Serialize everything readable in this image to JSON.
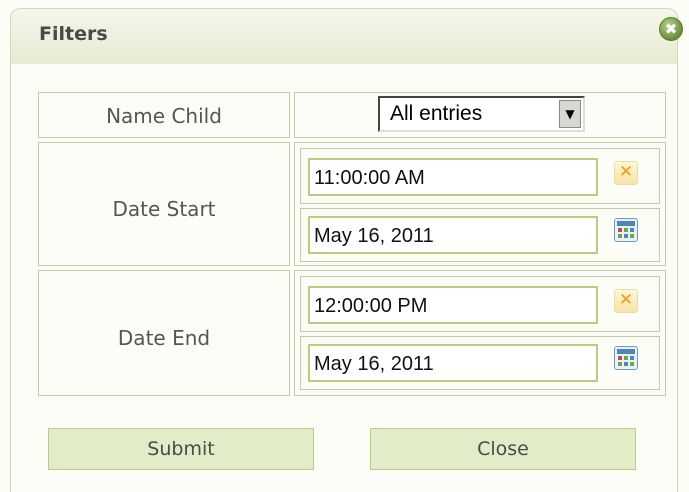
{
  "dialog": {
    "title": "Filters",
    "close_glyph": "✖",
    "accent_color": "#b5cf7d"
  },
  "rows": {
    "name_child": {
      "label": "Name Child",
      "select_value": "All entries",
      "select_arrow": "▼"
    },
    "date_start": {
      "label": "Date Start",
      "time_value": "11:00:00 AM",
      "date_value": "May 16, 2011",
      "clear_icon": "clear-icon",
      "calendar_icon": "calendar-icon"
    },
    "date_end": {
      "label": "Date End",
      "time_value": "12:00:00 PM",
      "date_value": "May 16, 2011",
      "clear_icon": "clear-icon",
      "calendar_icon": "calendar-icon"
    }
  },
  "buttons": {
    "submit_label": "Submit",
    "close_label": "Close"
  },
  "icons": {
    "clear_glyph": "✕"
  }
}
